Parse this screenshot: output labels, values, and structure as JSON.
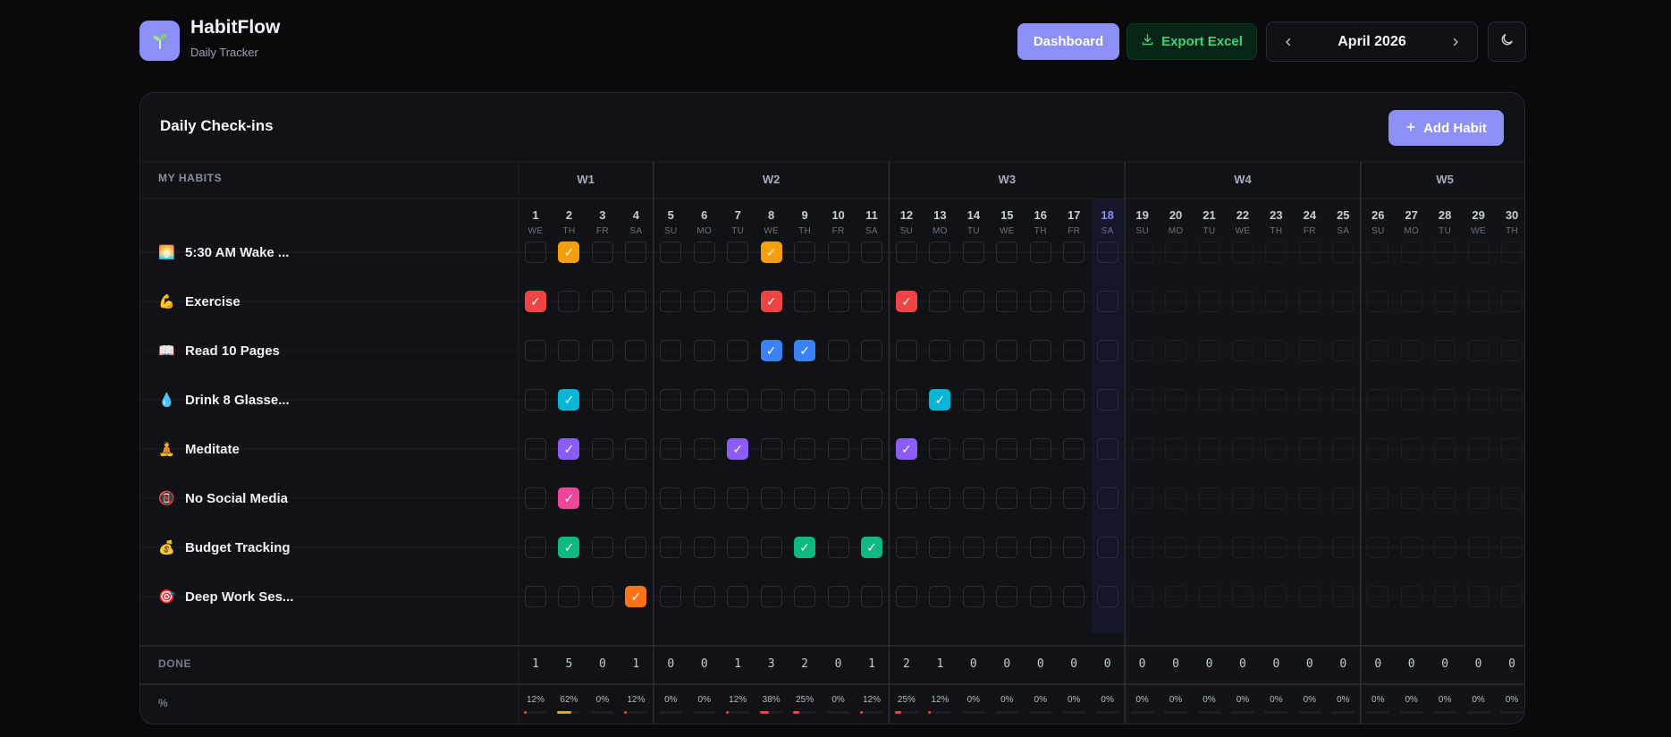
{
  "app": {
    "name": "HabitFlow",
    "subtitle": "Daily Tracker",
    "logo_icon": "sprout-icon"
  },
  "header": {
    "dashboard_label": "Dashboard",
    "export_label": "Export Excel",
    "month_label": "April 2026",
    "prev_icon": "chevron-left-icon",
    "next_icon": "chevron-right-icon",
    "theme_icon": "moon-icon"
  },
  "card": {
    "title": "Daily Check-ins",
    "add_label": "Add Habit"
  },
  "table": {
    "habits_header": "MY HABITS",
    "done_label": "DONE",
    "pct_label": "%",
    "today": 18,
    "weeks": [
      {
        "label": "W1",
        "days": [
          1,
          2,
          3,
          4
        ]
      },
      {
        "label": "W2",
        "days": [
          5,
          6,
          7,
          8,
          9,
          10,
          11
        ]
      },
      {
        "label": "W3",
        "days": [
          12,
          13,
          14,
          15,
          16,
          17,
          18
        ]
      },
      {
        "label": "W4",
        "days": [
          19,
          20,
          21,
          22,
          23,
          24,
          25
        ]
      },
      {
        "label": "W5",
        "days": [
          26,
          27,
          28,
          29,
          30
        ]
      }
    ],
    "day_names": [
      "WE",
      "TH",
      "FR",
      "SA",
      "SU",
      "MO",
      "TU",
      "WE",
      "TH",
      "FR",
      "SA",
      "SU",
      "MO",
      "TU",
      "WE",
      "TH",
      "FR",
      "SA",
      "SU",
      "MO",
      "TU",
      "WE",
      "TH",
      "FR",
      "SA",
      "SU",
      "MO",
      "TU",
      "WE",
      "TH"
    ],
    "habits": [
      {
        "emoji": "🌅",
        "name": "5:30 AM Wake ...",
        "color": "#f59e0b",
        "checked": [
          2,
          8
        ]
      },
      {
        "emoji": "💪",
        "name": "Exercise",
        "color": "#ef4444",
        "checked": [
          1,
          8,
          12
        ]
      },
      {
        "emoji": "📖",
        "name": "Read 10 Pages",
        "color": "#3b82f6",
        "checked": [
          8,
          9
        ]
      },
      {
        "emoji": "💧",
        "name": "Drink 8 Glasse...",
        "color": "#06b6d4",
        "checked": [
          2,
          13
        ]
      },
      {
        "emoji": "🧘",
        "name": "Meditate",
        "color": "#8b5cf6",
        "checked": [
          2,
          7,
          12
        ]
      },
      {
        "emoji": "📵",
        "name": "No Social Media",
        "color": "#ec4899",
        "checked": [
          2
        ]
      },
      {
        "emoji": "💰",
        "name": "Budget Tracking",
        "color": "#10b981",
        "checked": [
          2,
          9,
          11
        ]
      },
      {
        "emoji": "🎯",
        "name": "Deep Work Ses...",
        "color": "#f97316",
        "checked": [
          4
        ]
      }
    ],
    "done": [
      1,
      5,
      0,
      1,
      0,
      0,
      1,
      3,
      2,
      0,
      1,
      2,
      1,
      0,
      0,
      0,
      0,
      0,
      0,
      0,
      0,
      0,
      0,
      0,
      0,
      0,
      0,
      0,
      0,
      0
    ],
    "pct": [
      "12%",
      "62%",
      "0%",
      "12%",
      "0%",
      "0%",
      "12%",
      "38%",
      "25%",
      "0%",
      "12%",
      "25%",
      "12%",
      "0%",
      "0%",
      "0%",
      "0%",
      "0%",
      "0%",
      "0%",
      "0%",
      "0%",
      "0%",
      "0%",
      "0%",
      "0%",
      "0%",
      "0%",
      "0%",
      "0%"
    ]
  }
}
